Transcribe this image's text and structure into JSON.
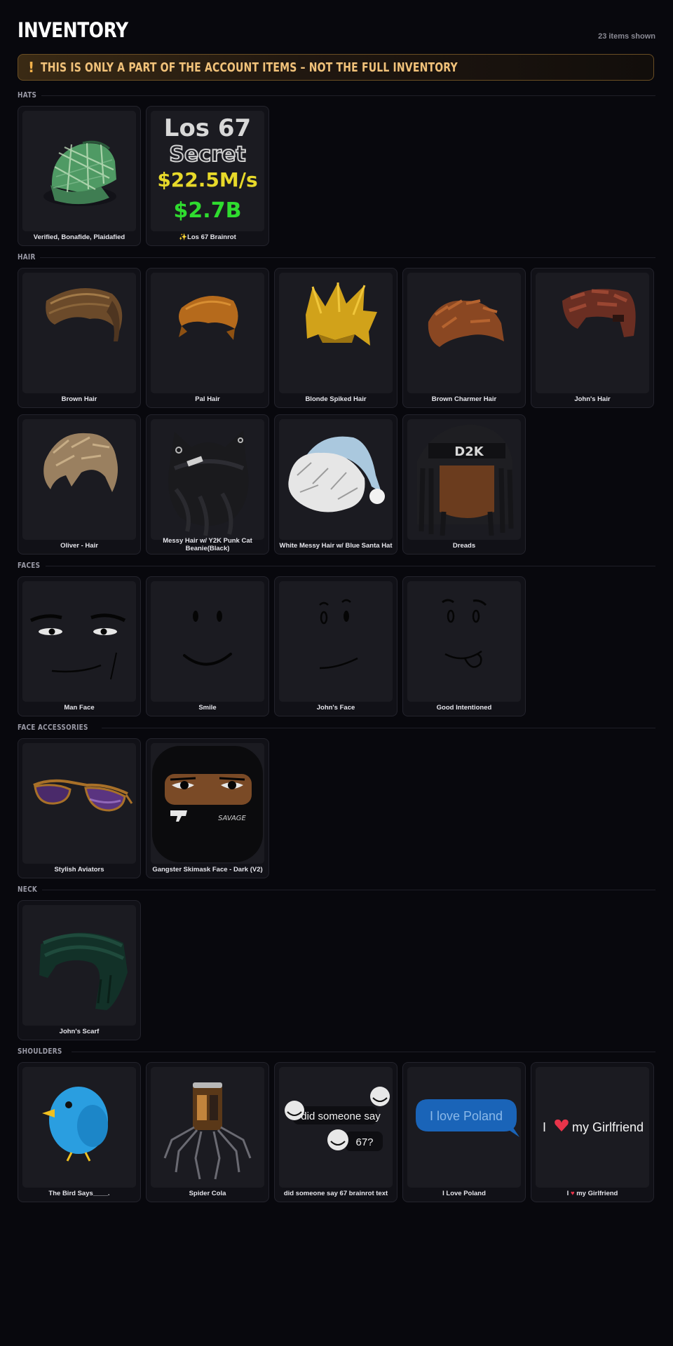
{
  "page": {
    "title": "INVENTORY",
    "item_count": "23 items shown",
    "banner": {
      "icon": "!",
      "text": "THIS IS ONLY A PART OF THE ACCOUNT ITEMS – NOT THE FULL INVENTORY"
    }
  },
  "sections": {
    "hats": {
      "label": "HATS",
      "items": [
        {
          "name": "Verified, Bonafide, Plaidafied",
          "icon": "plaid-cap-icon"
        },
        {
          "name": "✨Los 67 Brainrot",
          "icon": "los67-brainrot-icon",
          "art": {
            "line1": "Los 67",
            "line2": "Secret",
            "line3": "$22.5M/s",
            "line4": "$2.7B"
          }
        }
      ]
    },
    "hair": {
      "label": "HAIR",
      "items": [
        {
          "name": "Brown Hair",
          "icon": "brown-hair-icon"
        },
        {
          "name": "Pal Hair",
          "icon": "pal-hair-icon"
        },
        {
          "name": "Blonde Spiked Hair",
          "icon": "blonde-spiked-hair-icon"
        },
        {
          "name": "Brown Charmer Hair",
          "icon": "brown-charmer-hair-icon"
        },
        {
          "name": "John's Hair",
          "icon": "johns-hair-icon"
        },
        {
          "name": "Oliver - Hair",
          "icon": "oliver-hair-icon"
        },
        {
          "name": "Messy Hair w/ Y2K Punk Cat Beanie(Black)",
          "icon": "punk-cat-beanie-icon"
        },
        {
          "name": "White Messy Hair w/ Blue Santa Hat",
          "icon": "santa-hat-hair-icon"
        },
        {
          "name": "Dreads",
          "icon": "dreads-icon",
          "art": {
            "label": "D2K"
          }
        }
      ]
    },
    "faces": {
      "label": "FACES",
      "items": [
        {
          "name": "Man Face",
          "icon": "man-face-icon"
        },
        {
          "name": "Smile",
          "icon": "smile-face-icon"
        },
        {
          "name": "John's Face",
          "icon": "johns-face-icon"
        },
        {
          "name": "Good Intentioned",
          "icon": "good-intentioned-face-icon"
        }
      ]
    },
    "face_accessories": {
      "label": "FACE ACCESSORIES",
      "items": [
        {
          "name": "Stylish Aviators",
          "icon": "aviators-icon"
        },
        {
          "name": "Gangster Skimask Face - Dark (V2)",
          "icon": "skimask-icon",
          "art": {
            "label": "SAVAGE"
          }
        }
      ]
    },
    "neck": {
      "label": "NECK",
      "items": [
        {
          "name": "John's Scarf",
          "icon": "scarf-icon"
        }
      ]
    },
    "shoulders": {
      "label": "SHOULDERS",
      "items": [
        {
          "name": "The Bird Says____.",
          "icon": "blue-bird-icon"
        },
        {
          "name": "Spider Cola",
          "icon": "spider-cola-icon"
        },
        {
          "name": "did someone say 67 brainrot text",
          "icon": "troll-text-icon",
          "art": {
            "bubble1": "did someone say",
            "bubble2": "67?"
          }
        },
        {
          "name": "I Love Poland",
          "icon": "speech-bubble-icon",
          "art": {
            "text": "I love Poland"
          }
        },
        {
          "name_pre": "I",
          "name_post": "my Girlfriend",
          "icon": "heart-text-icon",
          "art": {
            "pre": "I",
            "post": "my Girlfriend"
          }
        }
      ]
    }
  },
  "colors": {
    "background": "#08080d",
    "card": "#111117",
    "thumb": "#1b1b21",
    "banner_text": "#f1c27a",
    "heart": "#e8344a"
  }
}
